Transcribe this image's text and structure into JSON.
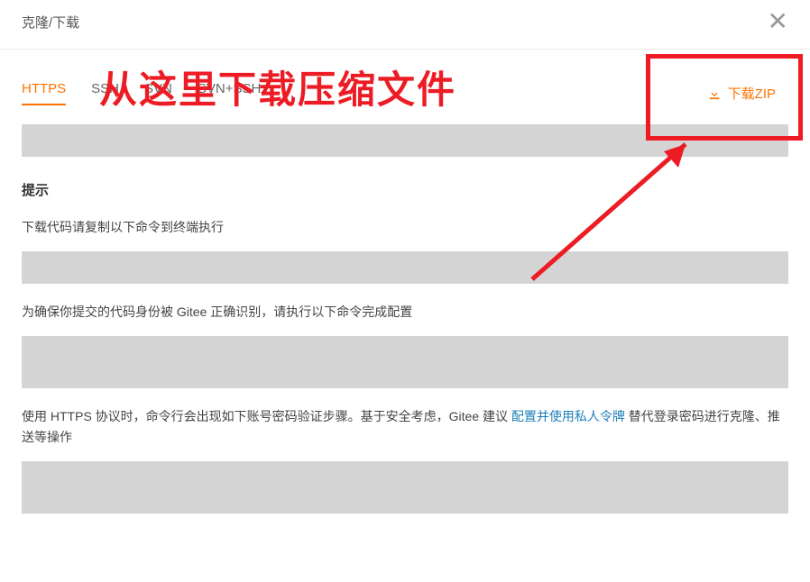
{
  "modal": {
    "title": "克隆/下载"
  },
  "tabs": {
    "https": "HTTPS",
    "ssh": "SSH",
    "svn": "SVN",
    "svnssh": "SVN+SSH"
  },
  "download": {
    "zip_label": "下载ZIP"
  },
  "hints": {
    "title": "提示",
    "copy_cmd": "下载代码请复制以下命令到终端执行",
    "identity": "为确保你提交的代码身份被 Gitee 正确识别，请执行以下命令完成配置",
    "https_note_prefix": "使用 HTTPS 协议时，命令行会出现如下账号密码验证步骤。基于安全考虑，Gitee 建议 ",
    "https_note_link": "配置并使用私人令牌",
    "https_note_suffix": " 替代登录密码进行克隆、推送等操作"
  },
  "annotation": {
    "text": "从这里下载压缩文件"
  }
}
